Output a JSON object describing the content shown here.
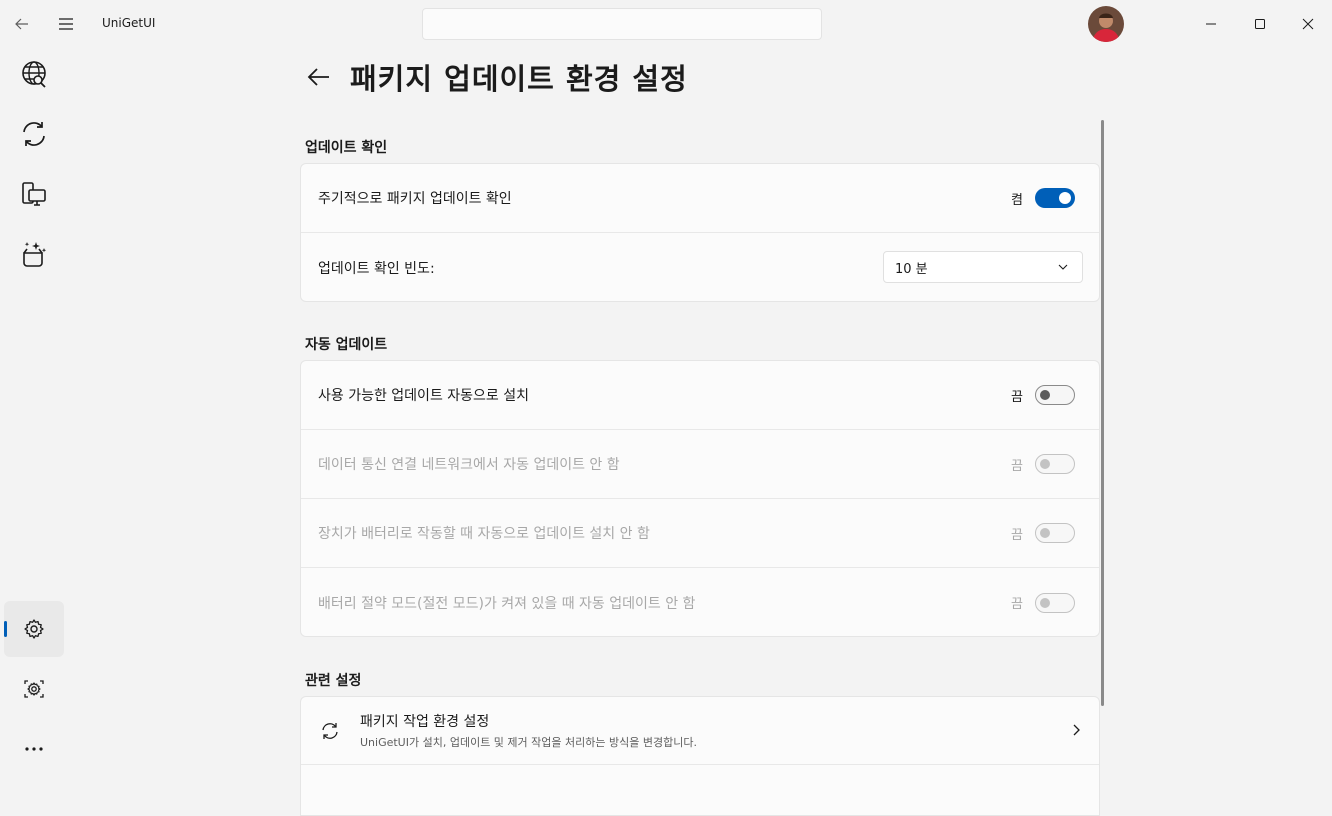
{
  "app": {
    "title": "UniGetUI"
  },
  "page": {
    "title": "패키지 업데이트 환경 설정"
  },
  "sections": {
    "update_check": {
      "title": "업데이트 확인",
      "periodic_label": "주기적으로 패키지 업데이트 확인",
      "periodic_state": "켬",
      "frequency_label": "업데이트 확인 빈도:",
      "frequency_value": "10 분"
    },
    "auto_update": {
      "title": "자동 업데이트",
      "items": [
        {
          "label": "사용 가능한 업데이트 자동으로 설치",
          "state": "끔"
        },
        {
          "label": "데이터 통신 연결 네트워크에서 자동 업데이트 안 함",
          "state": "끔"
        },
        {
          "label": "장치가 배터리로 작동할 때 자동으로 업데이트 설치 안 함",
          "state": "끔"
        },
        {
          "label": "배터리 절약 모드(절전 모드)가 켜져 있을 때 자동 업데이트 안 함",
          "state": "끔"
        }
      ]
    },
    "related": {
      "title": "관련 설정",
      "link_title": "패키지 작업 환경 설정",
      "link_desc": "UniGetUI가 설치, 업데이트 및 제거 작업을 처리하는 방식을 변경합니다."
    }
  },
  "colors": {
    "accent": "#005fb8"
  }
}
